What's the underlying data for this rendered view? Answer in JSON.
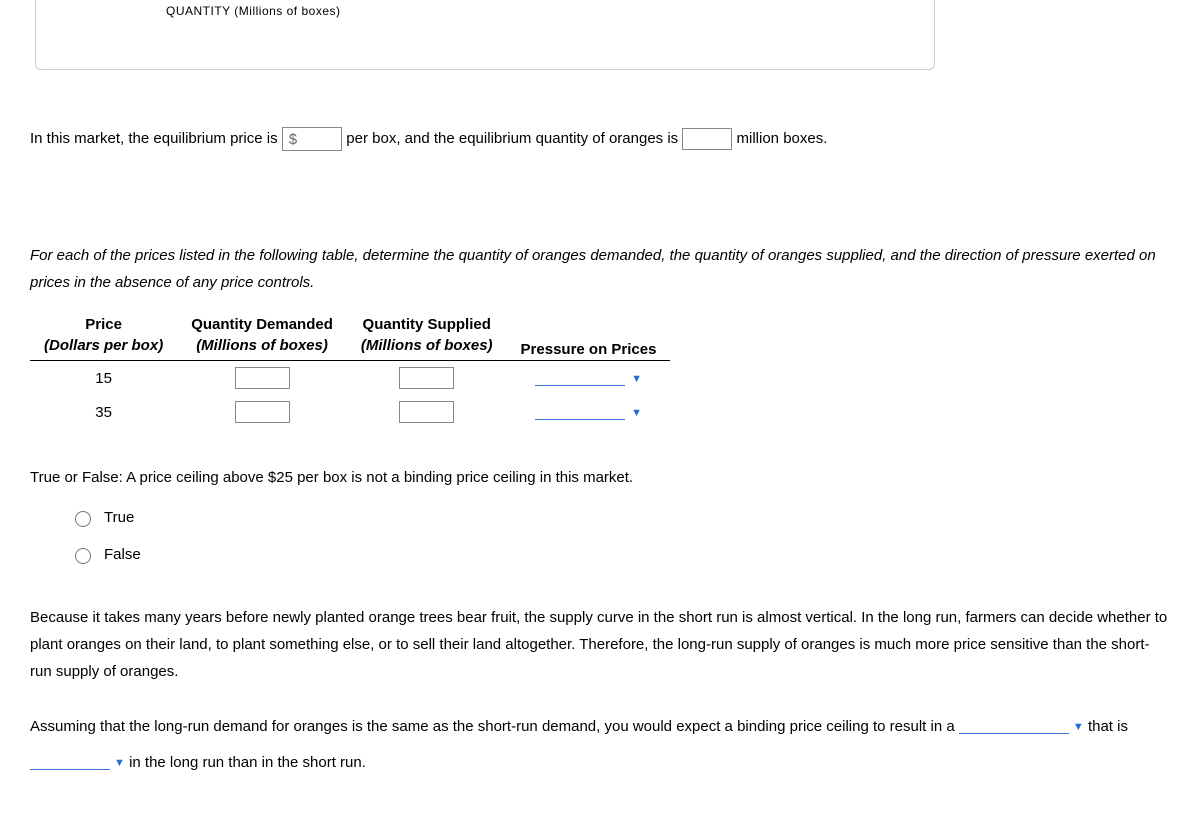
{
  "axis_label": "QUANTITY (Millions of boxes)",
  "equilibrium": {
    "pre": "In this market, the equilibrium price is",
    "dollar": "$",
    "mid": "per box, and the equilibrium quantity of oranges is",
    "tail": "million boxes."
  },
  "instruction": "For each of the prices listed in the following table, determine the quantity of oranges demanded, the quantity of oranges supplied, and the direction of pressure exerted on prices in the absence of any price controls.",
  "table": {
    "headers": {
      "price": "Price",
      "price_sub": "(Dollars per box)",
      "qd": "Quantity Demanded",
      "qd_sub": "(Millions of boxes)",
      "qs": "Quantity Supplied",
      "qs_sub": "(Millions of boxes)",
      "pressure": "Pressure on Prices"
    },
    "rows": [
      {
        "price": "15"
      },
      {
        "price": "35"
      }
    ]
  },
  "tf": {
    "question": "True or False: A price ceiling above $25 per box is not a binding price ceiling in this market.",
    "opt_true": "True",
    "opt_false": "False"
  },
  "paragraph": "Because it takes many years before newly planted orange trees bear fruit, the supply curve in the short run is almost vertical. In the long run, farmers can decide whether to plant oranges on their land, to plant something else, or to sell their land altogether. Therefore, the long-run supply of oranges is much more price sensitive than the short-run supply of oranges.",
  "final": {
    "pre": "Assuming that the long-run demand for oranges is the same as the short-run demand, you would expect a binding price ceiling to result in a",
    "mid": "that is",
    "tail": "in the long run than in the short run."
  }
}
